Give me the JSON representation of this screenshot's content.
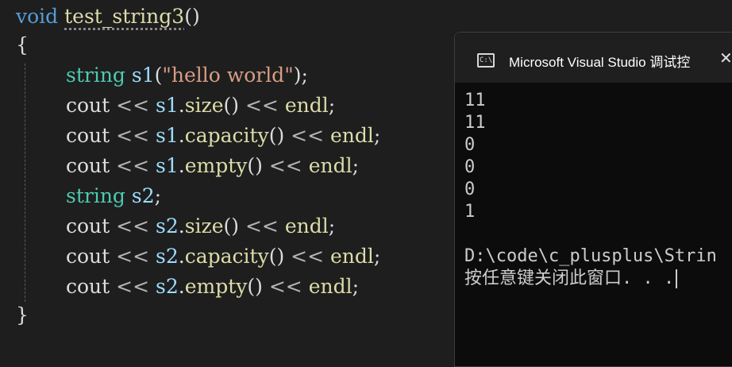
{
  "editor": {
    "line1": {
      "kw": "void",
      "fn": "test_string3",
      "paren": "()"
    },
    "line2": {
      "brace": "{"
    },
    "line3": {
      "type": "string",
      "var": "s1",
      "open": "(",
      "str": "\"hello world\"",
      "close": ");"
    },
    "line4": {
      "cout": "cout",
      "op1": " << ",
      "var": "s1",
      "dot": ".",
      "fn": "size",
      "par": "()",
      "op2": " << ",
      "endl": "endl",
      "semi": ";"
    },
    "line5": {
      "cout": "cout",
      "op1": " << ",
      "var": "s1",
      "dot": ".",
      "fn": "capacity",
      "par": "()",
      "op2": " << ",
      "endl": "endl",
      "semi": ";"
    },
    "line6": {
      "cout": "cout",
      "op1": " << ",
      "var": "s1",
      "dot": ".",
      "fn": "empty",
      "par": "()",
      "op2": " << ",
      "endl": "endl",
      "semi": ";"
    },
    "line7": {
      "type": "string",
      "var": "s2",
      "semi": ";"
    },
    "line8": {
      "cout": "cout",
      "op1": " << ",
      "var": "s2",
      "dot": ".",
      "fn": "size",
      "par": "()",
      "op2": " << ",
      "endl": "endl",
      "semi": ";"
    },
    "line9": {
      "cout": "cout",
      "op1": " << ",
      "var": "s2",
      "dot": ".",
      "fn": "capacity",
      "par": "()",
      "op2": " << ",
      "endl": "endl",
      "semi": ";"
    },
    "line10": {
      "cout": "cout",
      "op1": " << ",
      "var": "s2",
      "dot": ".",
      "fn": "empty",
      "par": "()",
      "op2": " << ",
      "endl": "endl",
      "semi": ";"
    },
    "line11": {
      "brace": "}"
    }
  },
  "console": {
    "icon_label": "C:\\",
    "title": "Microsoft Visual Studio 调试控",
    "close": "✕",
    "output": [
      "11",
      "11",
      "0",
      "0",
      "0",
      "1",
      "",
      "D:\\code\\c_plusplus\\Strin",
      "按任意键关闭此窗口. . ."
    ]
  },
  "colors": {
    "keyword": "#569cd6",
    "type": "#4ec9b0",
    "function": "#dcdcaa",
    "variable": "#9cdcfe",
    "string": "#d69d85",
    "console_bg": "#0c0c0c"
  },
  "icons": {
    "console": "console-icon",
    "close": "close-icon"
  }
}
